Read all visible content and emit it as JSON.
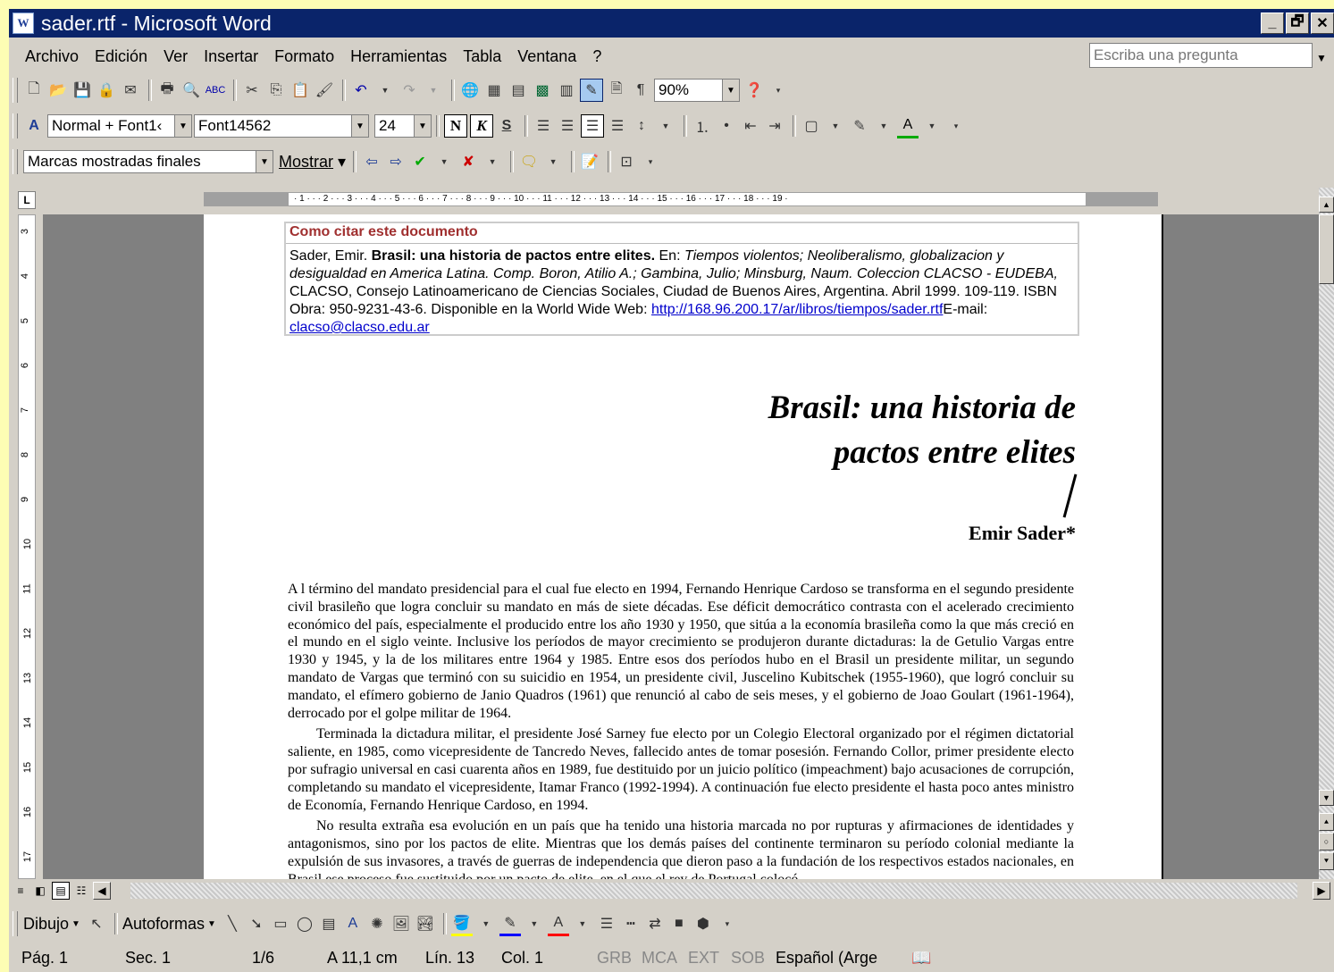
{
  "window": {
    "title": "sader.rtf - Microsoft Word",
    "min": "_",
    "max": "🗗",
    "close": "✕"
  },
  "menu": [
    "Archivo",
    "Edición",
    "Ver",
    "Insertar",
    "Formato",
    "Herramientas",
    "Tabla",
    "Ventana",
    "?"
  ],
  "ask": {
    "placeholder": "Escriba una pregunta"
  },
  "std_toolbar": {
    "zoom": "90%"
  },
  "format_toolbar": {
    "style": "Normal + Font1‹",
    "font": "Font14562",
    "size": "24",
    "bold": "N",
    "italic": "K",
    "underline": "S"
  },
  "review_toolbar": {
    "markup": "Marcas mostradas finales",
    "show": "Mostrar"
  },
  "ruler": {
    "numbers": "· 1 · · · 2 · · · 3 · · · 4 · · · 5 · · · 6 · · · 7 · · · 8 · · · 9 · · · 10 · · · 11 · · · 12 · · · 13 · · · 14 · · · 15 · · · 16 · · · 17 · · · 18 · · · 19 ·",
    "vnums": [
      "3",
      "4",
      "5",
      "6",
      "7",
      "8",
      "9",
      "10",
      "11",
      "12",
      "13",
      "14",
      "15",
      "16",
      "17"
    ]
  },
  "cite": {
    "heading": "Como citar este documento",
    "author": "Sader, Emir.",
    "title": "Brasil: una historia de pactos entre elites.",
    "in": "En:",
    "book": "Tiempos violentos; Neoliberalismo, globalizacion y desigualdad en America Latina. Comp. Boron, Atilio A.; Gambina, Julio; Minsburg, Naum. Coleccion CLACSO - EUDEBA,",
    "rest": "CLACSO, Consejo Latinoamericano de Ciencias Sociales, Ciudad de Buenos Aires, Argentina. Abril 1999. 109-119. ISBN Obra: 950-9231-43-6. Disponible en la World Wide Web:",
    "url": "http://168.96.200.17/ar/libros/tiempos/sader.rtf",
    "email_label": "E-mail:",
    "email": "clacso@clacso.edu.ar"
  },
  "doc": {
    "title_line1": "Brasil: una historia de",
    "title_line2": "pactos entre elites",
    "author": "Emir Sader*",
    "p1": "A l término del mandato presidencial para el cual fue electo en 1994, Fernando Henrique Cardoso se transforma en el segundo presidente civil brasileño que logra concluir su mandato en más de siete décadas. Ese déficit democrático contrasta con el acelerado crecimiento económico del país, especialmente el producido entre los año 1930 y 1950, que sitúa a la economía brasileña como la que más creció en el mundo en el siglo veinte. Inclusive los períodos de mayor crecimiento se produjeron durante dictaduras: la de Getulio Vargas entre 1930 y 1945, y la de los militares entre 1964 y 1985. Entre esos dos períodos hubo en el Brasil un presidente militar, un segundo mandato de Vargas que terminó con su suicidio en 1954, un presidente civil, Juscelino Kubitschek (1955-1960), que logró concluir su mandato, el efímero gobierno de Janio Quadros (1961) que renunció al cabo de seis meses, y el gobierno de Joao Goulart (1961-1964), derrocado por el golpe militar de 1964.",
    "p2": "Terminada la dictadura militar, el presidente José Sarney fue electo por un Colegio Electoral organizado por el régimen dictatorial saliente, en 1985, como vicepresidente de Tancredo Neves, fallecido antes de tomar posesión. Fernando Collor, primer presidente electo por sufragio universal en casi cuarenta años en 1989, fue destituido por un juicio político (impeachment) bajo acusaciones de corrupción, completando su mandato el vicepresidente, Itamar Franco (1992-1994). A continuación fue electo presidente el hasta poco antes ministro de Economía, Fernando Henrique Cardoso, en 1994.",
    "p3": "No resulta extraña esa evolución en un país que ha tenido una historia marcada no por rupturas y afirmaciones de identidades y antagonismos, sino por los pactos de elite. Mientras que los demás países del continente terminaron su período colonial mediante la expulsión de sus invasores, a través de guerras de independencia que dieron paso a la fundación de los respectivos estados nacionales, en Brasil ese proceso fue sustituido por un pacto de elite, en el que el rey de Portugal colocó"
  },
  "drawing": {
    "draw": "Dibujo",
    "autoshapes": "Autoformas"
  },
  "statusbar": {
    "page": "Pág. 1",
    "sec": "Sec. 1",
    "pages": "1/6",
    "at": "A 11,1 cm",
    "line": "Lín. 13",
    "col": "Col. 1",
    "rec": "GRB",
    "trk": "MCA",
    "ext": "EXT",
    "ovr": "SOB",
    "lang": "Español (Arge"
  }
}
